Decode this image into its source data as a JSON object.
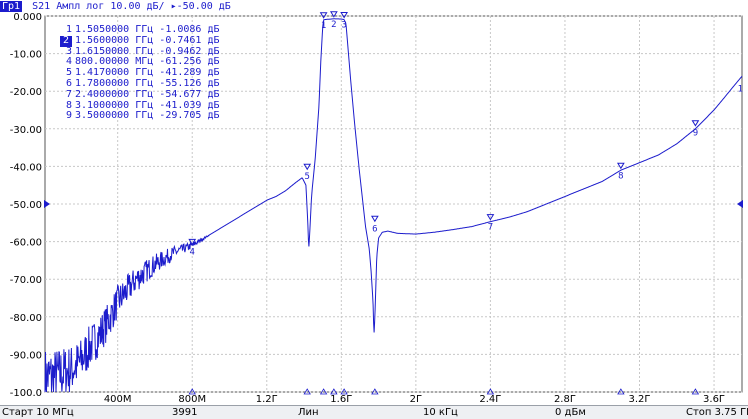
{
  "header": {
    "trace_id": "Гр1",
    "measurement": "S21",
    "format": "Ампл лог",
    "scale": "10.00 дБ/",
    "ref_marker": "▸",
    "ref_value": "-50.00 дБ"
  },
  "y_axis": {
    "ticks": [
      "0.000",
      "-10.00",
      "-20.00",
      "-30.00",
      "-40.00",
      "-50.00",
      "-60.00",
      "-70.00",
      "-80.00",
      "-90.00",
      "-100.0"
    ],
    "values": [
      0,
      -10,
      -20,
      -30,
      -40,
      -50,
      -60,
      -70,
      -80,
      -90,
      -100
    ]
  },
  "x_axis": {
    "ticks": [
      "400М",
      "800М",
      "1.2Г",
      "1.6Г",
      "2Г",
      "2.4Г",
      "2.8Г",
      "3.2Г",
      "3.6Г"
    ],
    "values_ghz": [
      0.4,
      0.8,
      1.2,
      1.6,
      2.0,
      2.4,
      2.8,
      3.2,
      3.6
    ]
  },
  "ref_arrows": {
    "left": "-50.00",
    "right": "-50.00",
    "right_trace_label": "1"
  },
  "markers": {
    "active": "2",
    "rows": [
      {
        "num": "1",
        "freq": "1.5050000 ГГц",
        "value": "-1.0086 дБ",
        "x_ghz": 1.505,
        "y_db": -1.0086
      },
      {
        "num": "2",
        "freq": "1.5600000 ГГц",
        "value": "-0.7461 дБ",
        "x_ghz": 1.56,
        "y_db": -0.7461
      },
      {
        "num": "3",
        "freq": "1.6150000 ГГц",
        "value": "-0.9462 дБ",
        "x_ghz": 1.615,
        "y_db": -0.9462
      },
      {
        "num": "4",
        "freq": "800.00000 МГц",
        "value": "-61.256 дБ",
        "x_ghz": 0.8,
        "y_db": -61.256
      },
      {
        "num": "5",
        "freq": "1.4170000 ГГц",
        "value": "-41.289 дБ",
        "x_ghz": 1.417,
        "y_db": -41.289
      },
      {
        "num": "6",
        "freq": "1.7800000 ГГц",
        "value": "-55.126 дБ",
        "x_ghz": 1.78,
        "y_db": -55.126
      },
      {
        "num": "7",
        "freq": "2.4000000 ГГц",
        "value": "-54.677 дБ",
        "x_ghz": 2.4,
        "y_db": -54.677
      },
      {
        "num": "8",
        "freq": "3.1000000 ГГц",
        "value": "-41.039 дБ",
        "x_ghz": 3.1,
        "y_db": -41.039
      },
      {
        "num": "9",
        "freq": "3.5000000 ГГц",
        "value": "-29.705 дБ",
        "x_ghz": 3.5,
        "y_db": -29.705
      }
    ]
  },
  "footer": {
    "start": "Старт 10 МГц",
    "points": "3991",
    "sweep_type": "Лин",
    "if_bandwidth": "10 кГц",
    "power": "0 дБм",
    "stop": "Стоп 3.75 ГГц"
  },
  "chart_data": {
    "type": "line",
    "series": [
      {
        "x": [
          0.01,
          0.05,
          0.1,
          0.15,
          0.2,
          0.25,
          0.3,
          0.35,
          0.4,
          0.5,
          0.6,
          0.7,
          0.8,
          0.9,
          1.0,
          1.1,
          1.2,
          1.25,
          1.3,
          1.35,
          1.39,
          1.41,
          1.42,
          1.425,
          1.43,
          1.44,
          1.46,
          1.48,
          1.49,
          1.5,
          1.505,
          1.52,
          1.56,
          1.6,
          1.615,
          1.625,
          1.635,
          1.65,
          1.67,
          1.69,
          1.71,
          1.73,
          1.75,
          1.76,
          1.77,
          1.775,
          1.78,
          1.785,
          1.79,
          1.8,
          1.82,
          1.85,
          1.9,
          2.0,
          2.1,
          2.2,
          2.3,
          2.4,
          2.5,
          2.6,
          2.7,
          2.8,
          2.9,
          3.0,
          3.1,
          3.2,
          3.3,
          3.4,
          3.5,
          3.6,
          3.7,
          3.75
        ],
        "y": [
          -96,
          -96,
          -95,
          -94,
          -92,
          -88,
          -85,
          -81,
          -76,
          -70,
          -66,
          -63,
          -61,
          -58,
          -55,
          -52,
          -49,
          -48,
          -46.5,
          -44.5,
          -43,
          -45,
          -55,
          -62,
          -58,
          -48,
          -38,
          -24,
          -12,
          -3,
          -1.0,
          -0.9,
          -0.75,
          -0.8,
          -0.95,
          -2,
          -8,
          -17,
          -28,
          -38,
          -47,
          -56,
          -62,
          -68,
          -76,
          -85,
          -80,
          -72,
          -64,
          -59,
          -57.5,
          -57.2,
          -57.8,
          -58,
          -57.5,
          -56.8,
          -56,
          -54.7,
          -53.5,
          -52,
          -50,
          -48,
          -46,
          -44,
          -41,
          -39,
          -37,
          -34,
          -30,
          -25,
          -19,
          -16
        ]
      }
    ],
    "xlim": [
      0.01,
      3.75
    ],
    "ylim": [
      -100,
      0
    ]
  }
}
